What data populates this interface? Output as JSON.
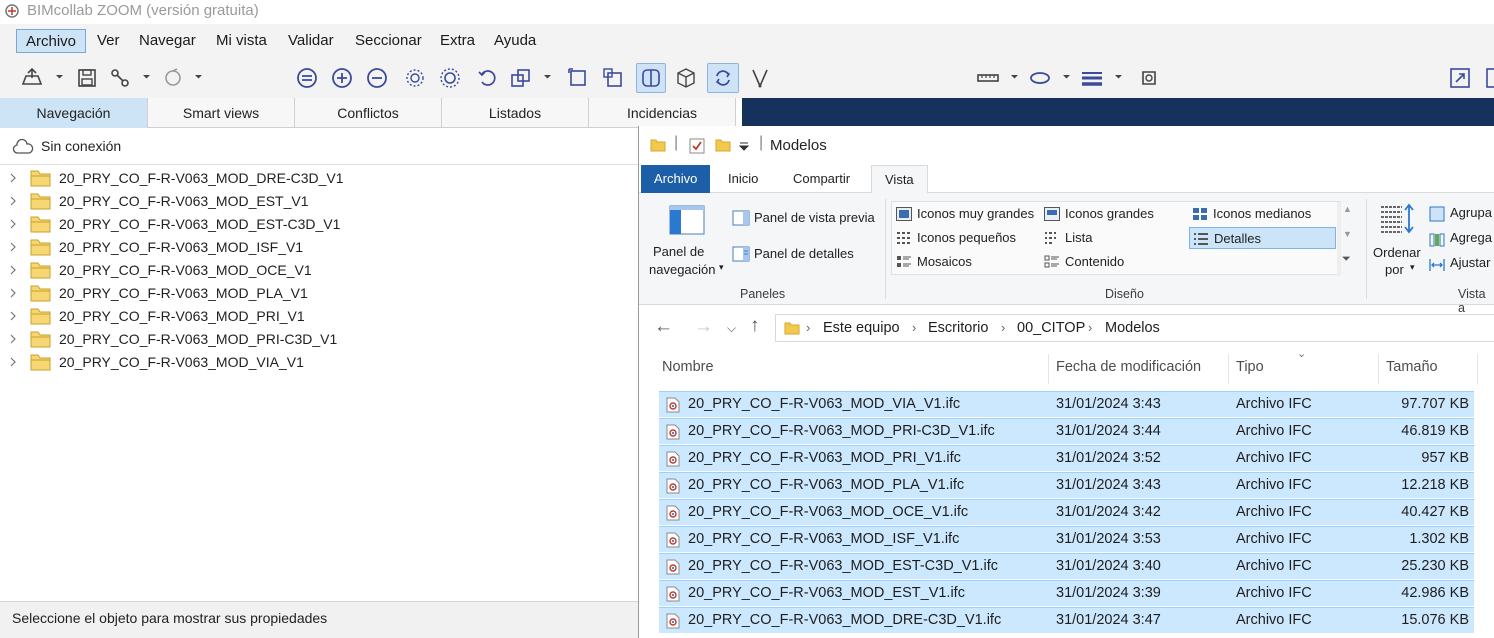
{
  "app": {
    "title": "BIMcollab ZOOM (versión gratuita)",
    "menu": [
      "Archivo",
      "Ver",
      "Navegar",
      "Mi vista",
      "Validar",
      "Seccionar",
      "Extra",
      "Ayuda"
    ],
    "active_menu": "Archivo",
    "tabs": [
      "Navegación",
      "Smart views",
      "Conflictos",
      "Listados",
      "Incidencias"
    ],
    "active_tab": "Navegación",
    "connection": "Sin conexión",
    "tree": [
      "20_PRY_CO_F-R-V063_MOD_DRE-C3D_V1",
      "20_PRY_CO_F-R-V063_MOD_EST_V1",
      "20_PRY_CO_F-R-V063_MOD_EST-C3D_V1",
      "20_PRY_CO_F-R-V063_MOD_ISF_V1",
      "20_PRY_CO_F-R-V063_MOD_OCE_V1",
      "20_PRY_CO_F-R-V063_MOD_PLA_V1",
      "20_PRY_CO_F-R-V063_MOD_PRI_V1",
      "20_PRY_CO_F-R-V063_MOD_PRI-C3D_V1",
      "20_PRY_CO_F-R-V063_MOD_VIA_V1"
    ],
    "status": "Seleccione el objeto para mostrar sus propiedades"
  },
  "explorer": {
    "title": "Modelos",
    "ribbon_tabs": [
      "Archivo",
      "Inicio",
      "Compartir",
      "Vista"
    ],
    "active_ribbon_tab": "Vista",
    "panes": {
      "nav_pane": [
        "Panel de",
        "navegación"
      ],
      "preview": "Panel de vista previa",
      "details": "Panel de detalles",
      "group": "Paneles"
    },
    "layout": {
      "items": [
        "Iconos muy grandes",
        "Iconos grandes",
        "Iconos medianos",
        "Iconos pequeños",
        "Lista",
        "Detalles",
        "Mosaicos",
        "Contenido"
      ],
      "selected": "Detalles",
      "group": "Diseño"
    },
    "current_view": {
      "sort": [
        "Ordenar",
        "por"
      ],
      "items": [
        "Agrupa",
        "Agrega",
        "Ajustar"
      ],
      "group": "Vista a"
    },
    "breadcrumb": [
      "Este equipo",
      "Escritorio",
      "00_CITOP",
      "Modelos"
    ],
    "columns": [
      "Nombre",
      "Fecha de modificación",
      "Tipo",
      "Tamaño"
    ],
    "files": [
      {
        "name": "20_PRY_CO_F-R-V063_MOD_VIA_V1.ifc",
        "date": "31/01/2024 3:43",
        "type": "Archivo IFC",
        "size": "97.707 KB"
      },
      {
        "name": "20_PRY_CO_F-R-V063_MOD_PRI-C3D_V1.ifc",
        "date": "31/01/2024 3:44",
        "type": "Archivo IFC",
        "size": "46.819 KB"
      },
      {
        "name": "20_PRY_CO_F-R-V063_MOD_PRI_V1.ifc",
        "date": "31/01/2024 3:52",
        "type": "Archivo IFC",
        "size": "957 KB"
      },
      {
        "name": "20_PRY_CO_F-R-V063_MOD_PLA_V1.ifc",
        "date": "31/01/2024 3:43",
        "type": "Archivo IFC",
        "size": "12.218 KB"
      },
      {
        "name": "20_PRY_CO_F-R-V063_MOD_OCE_V1.ifc",
        "date": "31/01/2024 3:42",
        "type": "Archivo IFC",
        "size": "40.427 KB"
      },
      {
        "name": "20_PRY_CO_F-R-V063_MOD_ISF_V1.ifc",
        "date": "31/01/2024 3:53",
        "type": "Archivo IFC",
        "size": "1.302 KB"
      },
      {
        "name": "20_PRY_CO_F-R-V063_MOD_EST-C3D_V1.ifc",
        "date": "31/01/2024 3:40",
        "type": "Archivo IFC",
        "size": "25.230 KB"
      },
      {
        "name": "20_PRY_CO_F-R-V063_MOD_EST_V1.ifc",
        "date": "31/01/2024 3:39",
        "type": "Archivo IFC",
        "size": "42.986 KB"
      },
      {
        "name": "20_PRY_CO_F-R-V063_MOD_DRE-C3D_V1.ifc",
        "date": "31/01/2024 3:47",
        "type": "Archivo IFC",
        "size": "15.076 KB"
      }
    ]
  },
  "colors": {
    "selection": "#cce8ff",
    "ribbon_file_tab": "#1d5ea8",
    "dark_band": "#16325c",
    "folder": "#f2c94c"
  }
}
